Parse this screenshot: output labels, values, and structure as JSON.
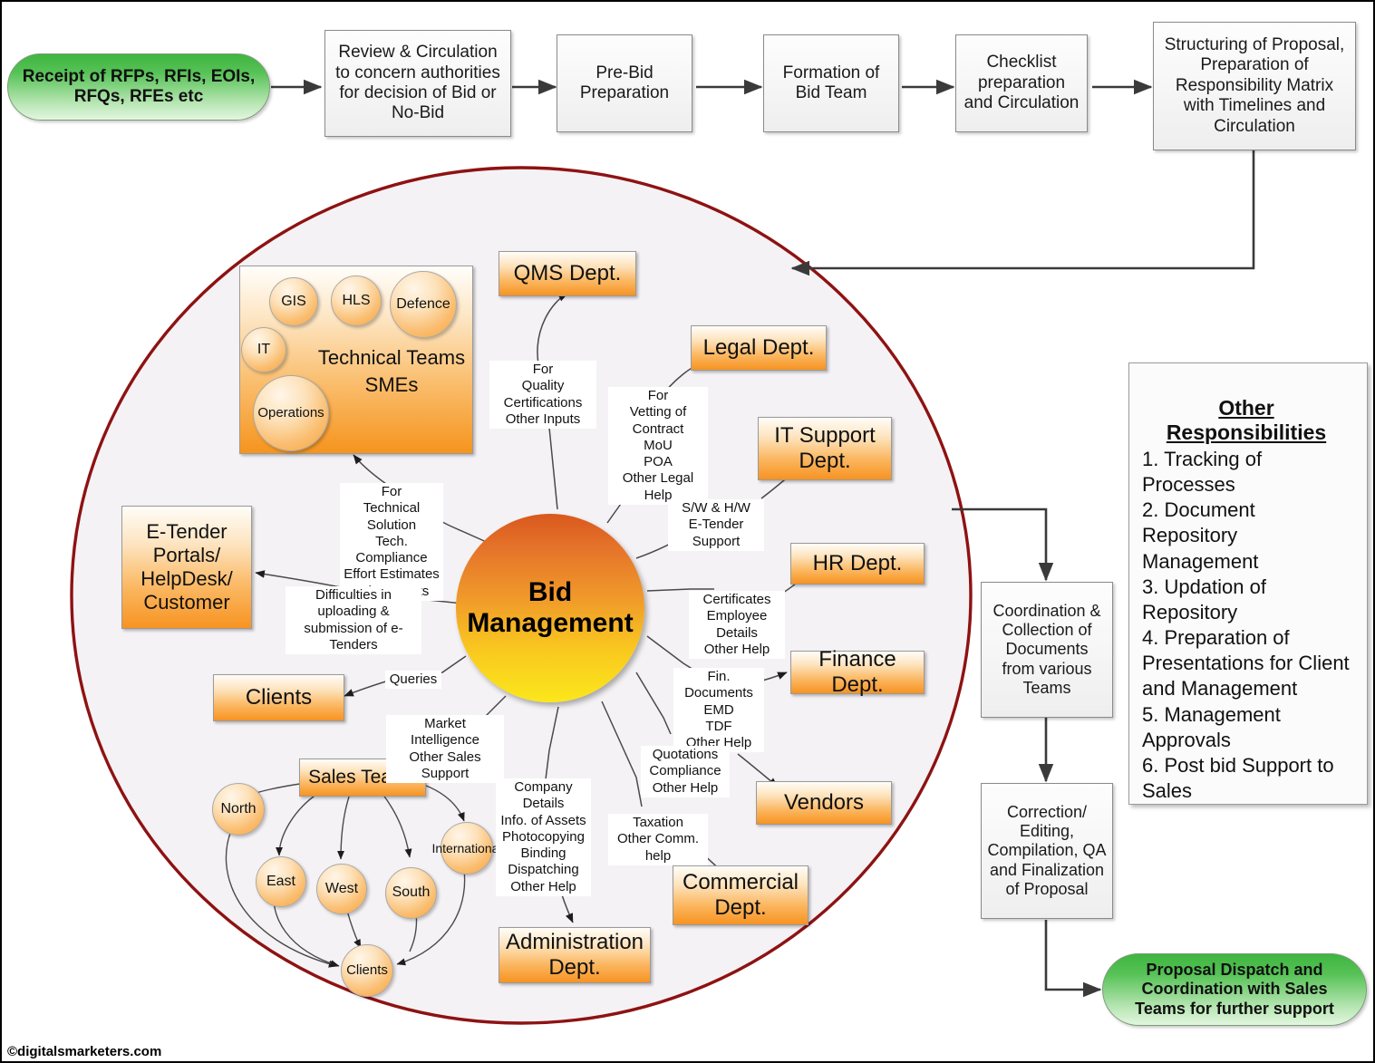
{
  "colors": {
    "ellipse_border": "#8e1212",
    "ellipse_fill": "#f4f2f5",
    "orange_accent": "#f79321",
    "green_accent": "#3fb53f",
    "connector": "#444444"
  },
  "top_flow": [
    {
      "id": "receipt",
      "type": "terminator",
      "label": "Receipt of RFPs, RFIs, EOIs, RFQs, RFEs etc"
    },
    {
      "id": "review",
      "type": "process",
      "label": "Review & Circulation to concern authorities for decision of Bid or No-Bid"
    },
    {
      "id": "prebid",
      "type": "process",
      "label": "Pre-Bid Preparation"
    },
    {
      "id": "bidteam",
      "type": "process",
      "label": "Formation of Bid Team"
    },
    {
      "id": "checklist",
      "type": "process",
      "label": "Checklist preparation and Circulation"
    },
    {
      "id": "structuring",
      "type": "process",
      "label": "Structuring of Proposal, Preparation of Responsibility Matrix with Timelines and Circulation"
    }
  ],
  "hub": {
    "label": "Bid Management"
  },
  "tech_teams": {
    "title_line1": "Technical Teams",
    "title_line2": "SMEs",
    "bubbles": [
      "GIS",
      "HLS",
      "Defence",
      "IT",
      "Operations"
    ]
  },
  "departments": [
    {
      "id": "qms",
      "label": "QMS Dept."
    },
    {
      "id": "legal",
      "label": "Legal Dept."
    },
    {
      "id": "itsupport",
      "label": "IT Support Dept."
    },
    {
      "id": "hr",
      "label": "HR Dept."
    },
    {
      "id": "finance",
      "label": "Finance Dept."
    },
    {
      "id": "vendors",
      "label": "Vendors"
    },
    {
      "id": "commercial",
      "label": "Commercial Dept."
    },
    {
      "id": "administration",
      "label": "Administration Dept."
    },
    {
      "id": "clients",
      "label": "Clients"
    },
    {
      "id": "etender",
      "label": "E-Tender Portals/ HelpDesk/ Customer"
    },
    {
      "id": "salesteams",
      "label": "Sales Teams"
    }
  ],
  "sales_regions": [
    "North",
    "East",
    "West",
    "South",
    "International",
    "Clients"
  ],
  "edge_labels": {
    "qms": "For\nQuality Certifications\nOther Inputs",
    "legal": "For\nVetting of  Contract\nMoU\nPOA\nOther Legal Help",
    "itsupport": "S/W & H/W\nE-Tender Support",
    "hr": "Certificates\nEmployee Details\nOther Help",
    "finance": "Fin. Documents\nEMD\nTDF\nOther Help",
    "vendors": "Quotations\nCompliance\nOther Help",
    "commercial": "Taxation\nOther Comm. help",
    "administration": "Company Details\nInfo. of Assets\nPhotocopying\nBinding\nDispatching\nOther Help",
    "tech_teams": "For\nTechnical Solution\nTech. Compliance\nEffort Estimates\nOther Inputs",
    "etender": "Difficulties in uploading &\nsubmission of e-Tenders",
    "clients": "Queries",
    "salesteams": "Market Intelligence\nOther Sales Support"
  },
  "right_flow": [
    {
      "id": "coordination",
      "type": "process",
      "label": "Coordination & Collection of Documents from various Teams"
    },
    {
      "id": "correction",
      "type": "process",
      "label": "Correction/ Editing, Compilation, QA and Finalization of Proposal"
    },
    {
      "id": "dispatch",
      "type": "terminator",
      "label": "Proposal Dispatch and Coordination with Sales Teams for further support"
    }
  ],
  "responsibilities": {
    "title": "Other Responsibilities",
    "items": [
      "1. Tracking of Processes",
      "2. Document Repository Management",
      "3. Updation of Repository",
      "4. Preparation of Presentations for Client and Management",
      "5. Management Approvals",
      "6. Post bid Support to Sales"
    ]
  },
  "watermark": "©digitalsmarketers.com"
}
